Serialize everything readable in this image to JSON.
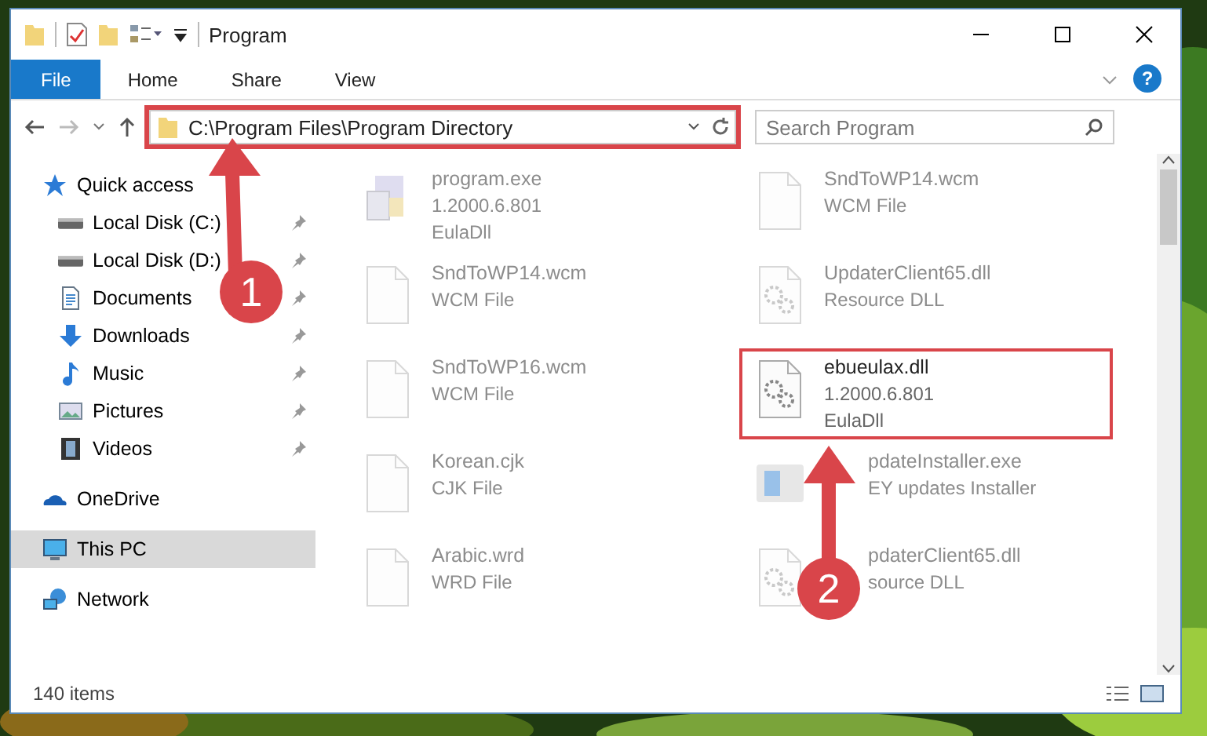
{
  "window": {
    "title": "Program"
  },
  "ribbon": {
    "tabs": [
      {
        "label": "File",
        "selected": true
      },
      {
        "label": "Home",
        "selected": false
      },
      {
        "label": "Share",
        "selected": false
      },
      {
        "label": "View",
        "selected": false
      }
    ],
    "help": "?"
  },
  "address": {
    "path": "C:\\Program Files\\Program Directory",
    "highlighted": true
  },
  "search": {
    "placeholder": "Search Program"
  },
  "sidebar": {
    "items": [
      {
        "label": "Quick access",
        "kind": "star",
        "selected": false,
        "children": [
          {
            "label": "Local Disk (C:)",
            "kind": "disk",
            "pinned": true,
            "selected": false
          },
          {
            "label": "Local Disk (D:)",
            "kind": "disk",
            "pinned": true,
            "selected": false
          },
          {
            "label": "Documents",
            "kind": "document",
            "pinned": true,
            "selected": false
          },
          {
            "label": "Downloads",
            "kind": "download",
            "pinned": true,
            "selected": false
          },
          {
            "label": "Music",
            "kind": "music",
            "pinned": true,
            "selected": false
          },
          {
            "label": "Pictures",
            "kind": "pictures",
            "pinned": true,
            "selected": false
          },
          {
            "label": "Videos",
            "kind": "video",
            "pinned": true,
            "selected": false
          }
        ]
      },
      {
        "label": "OneDrive",
        "kind": "cloud",
        "selected": false
      },
      {
        "label": "This PC",
        "kind": "computer",
        "selected": true
      },
      {
        "label": "Network",
        "kind": "network",
        "selected": false
      }
    ]
  },
  "files": [
    {
      "name": "program.exe",
      "details": [
        "1.2000.6.801",
        "EulaDll"
      ],
      "kind": "exe",
      "dimmed": true,
      "highlighted": false,
      "covered": false
    },
    {
      "name": "SndToWP14.wcm",
      "details": [
        "WCM File"
      ],
      "kind": "blank",
      "dimmed": true,
      "highlighted": false,
      "covered": false
    },
    {
      "name": "SndToWP14.wcm",
      "details": [
        "WCM File"
      ],
      "kind": "blank",
      "dimmed": true,
      "highlighted": false,
      "covered": false
    },
    {
      "name": "UpdaterClient65.dll",
      "details": [
        "Resource DLL"
      ],
      "kind": "dll",
      "dimmed": true,
      "highlighted": false,
      "covered": false
    },
    {
      "name": "SndToWP16.wcm",
      "details": [
        "WCM File"
      ],
      "kind": "blank",
      "dimmed": true,
      "highlighted": false,
      "covered": false
    },
    {
      "name": "ebueulax.dll",
      "details": [
        "1.2000.6.801",
        "EulaDll"
      ],
      "kind": "dll",
      "dimmed": false,
      "highlighted": true,
      "covered": false
    },
    {
      "name": "Korean.cjk",
      "details": [
        "CJK File"
      ],
      "kind": "blank",
      "dimmed": true,
      "highlighted": false,
      "covered": false
    },
    {
      "name": "pdateInstaller.exe",
      "details": [
        "EY updates Installer"
      ],
      "kind": "installer",
      "dimmed": true,
      "highlighted": false,
      "covered": true
    },
    {
      "name": "Arabic.wrd",
      "details": [
        "WRD File"
      ],
      "kind": "blank",
      "dimmed": true,
      "highlighted": false,
      "covered": false
    },
    {
      "name": "pdaterClient65.dll",
      "details": [
        "source DLL"
      ],
      "kind": "dll",
      "dimmed": true,
      "highlighted": false,
      "covered": true
    }
  ],
  "status_bar": {
    "count": "140 items"
  },
  "annotations": [
    {
      "number": "1"
    },
    {
      "number": "2"
    }
  ]
}
